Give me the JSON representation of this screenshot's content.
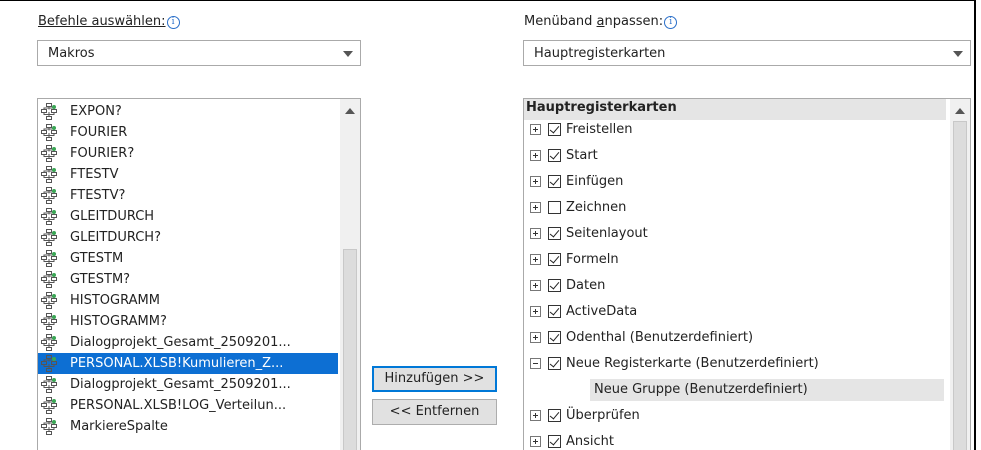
{
  "left": {
    "label": "Befehle auswählen:",
    "combo_value": "Makros",
    "items": [
      {
        "label": "EXPON?"
      },
      {
        "label": "FOURIER"
      },
      {
        "label": "FOURIER?"
      },
      {
        "label": "FTESTV"
      },
      {
        "label": "FTESTV?"
      },
      {
        "label": "GLEITDURCH"
      },
      {
        "label": "GLEITDURCH?"
      },
      {
        "label": "GTESTM"
      },
      {
        "label": "GTESTM?"
      },
      {
        "label": "HISTOGRAMM"
      },
      {
        "label": "HISTOGRAMM?"
      },
      {
        "label": "Dialogprojekt_Gesamt_2509201..."
      },
      {
        "label": "PERSONAL.XLSB!Kumulieren_Z...",
        "selected": true
      },
      {
        "label": "Dialogprojekt_Gesamt_2509201..."
      },
      {
        "label": "PERSONAL.XLSB!LOG_Verteilun..."
      },
      {
        "label": "MarkiereSpalte"
      }
    ]
  },
  "buttons": {
    "add": "Hinzufügen >>",
    "remove": "<< Entfernen"
  },
  "right": {
    "label_pre": "Menüband ",
    "label_u": "a",
    "label_post": "npassen:",
    "combo_value": "Hauptregisterkarten",
    "header": "Hauptregisterkarten",
    "rows": [
      {
        "label": "Freistellen",
        "checked": true,
        "expanded": false
      },
      {
        "label": "Start",
        "checked": true,
        "expanded": false
      },
      {
        "label": "Einfügen",
        "checked": true,
        "expanded": false
      },
      {
        "label": "Zeichnen",
        "checked": false,
        "expanded": false
      },
      {
        "label": "Seitenlayout",
        "checked": true,
        "expanded": false
      },
      {
        "label": "Formeln",
        "checked": true,
        "expanded": false
      },
      {
        "label": "Daten",
        "checked": true,
        "expanded": false
      },
      {
        "label": "ActiveData",
        "checked": true,
        "expanded": false
      },
      {
        "label": "Odenthal (Benutzerdefiniert)",
        "checked": true,
        "expanded": false
      },
      {
        "label": "Neue Registerkarte (Benutzerdefiniert)",
        "checked": true,
        "expanded": true
      },
      {
        "label": "Neue Gruppe (Benutzerdefiniert)",
        "group": true
      },
      {
        "label": "Überprüfen",
        "checked": true,
        "expanded": false
      },
      {
        "label": "Ansicht",
        "checked": true,
        "expanded": false
      }
    ]
  },
  "colors": {
    "selection": "#0d6fd3",
    "group_highlight": "#e5e5e5",
    "icon_blue": "#2a6fc9"
  }
}
